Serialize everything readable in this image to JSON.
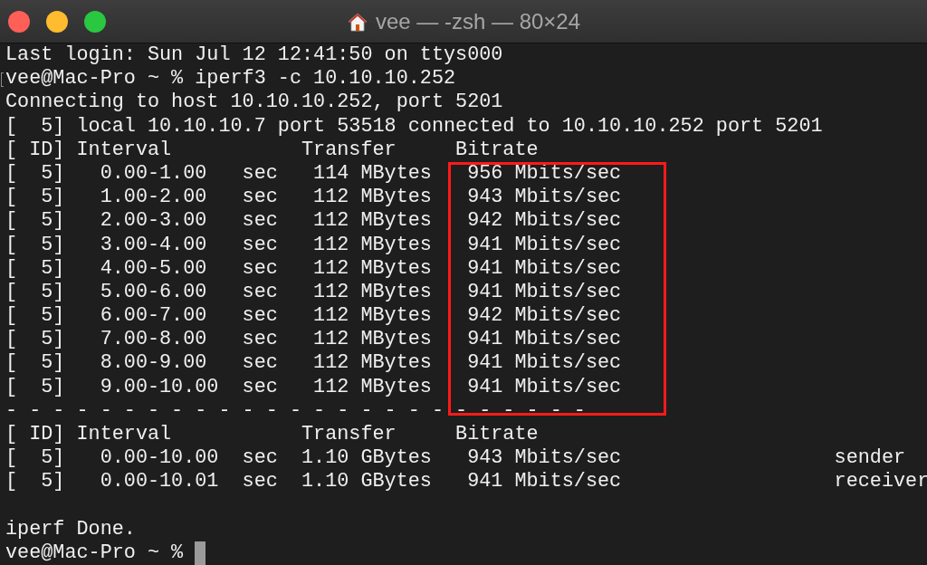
{
  "window": {
    "title": "vee — -zsh — 80×24"
  },
  "lines": [
    {
      "kind": "text",
      "text": "Last login: Sun Jul 12 12:41:50 on ttys000"
    },
    {
      "kind": "marked",
      "text": "vee@Mac-Pro ~ % iperf3 -c 10.10.10.252"
    },
    {
      "kind": "text",
      "text": "Connecting to host 10.10.10.252, port 5201"
    },
    {
      "kind": "text",
      "text": "[  5] local 10.10.10.7 port 53518 connected to 10.10.10.252 port 5201"
    },
    {
      "kind": "text",
      "text": "[ ID] Interval           Transfer     Bitrate"
    },
    {
      "kind": "text",
      "text": "[  5]   0.00-1.00   sec   114 MBytes   956 Mbits/sec"
    },
    {
      "kind": "text",
      "text": "[  5]   1.00-2.00   sec   112 MBytes   943 Mbits/sec"
    },
    {
      "kind": "text",
      "text": "[  5]   2.00-3.00   sec   112 MBytes   942 Mbits/sec"
    },
    {
      "kind": "text",
      "text": "[  5]   3.00-4.00   sec   112 MBytes   941 Mbits/sec"
    },
    {
      "kind": "text",
      "text": "[  5]   4.00-5.00   sec   112 MBytes   941 Mbits/sec"
    },
    {
      "kind": "text",
      "text": "[  5]   5.00-6.00   sec   112 MBytes   941 Mbits/sec"
    },
    {
      "kind": "text",
      "text": "[  5]   6.00-7.00   sec   112 MBytes   942 Mbits/sec"
    },
    {
      "kind": "text",
      "text": "[  5]   7.00-8.00   sec   112 MBytes   941 Mbits/sec"
    },
    {
      "kind": "text",
      "text": "[  5]   8.00-9.00   sec   112 MBytes   941 Mbits/sec"
    },
    {
      "kind": "text",
      "text": "[  5]   9.00-10.00  sec   112 MBytes   941 Mbits/sec"
    },
    {
      "kind": "text",
      "text": "- - - - - - - - - - - - - - - - - - - - - - - - -"
    },
    {
      "kind": "text",
      "text": "[ ID] Interval           Transfer     Bitrate"
    },
    {
      "kind": "text",
      "text": "[  5]   0.00-10.00  sec  1.10 GBytes   943 Mbits/sec                  sender"
    },
    {
      "kind": "text",
      "text": "[  5]   0.00-10.01  sec  1.10 GBytes   941 Mbits/sec                  receiver"
    },
    {
      "kind": "blank"
    },
    {
      "kind": "text",
      "text": "iperf Done."
    },
    {
      "kind": "prompt",
      "text": "vee@Mac-Pro ~ % "
    }
  ],
  "annotation": {
    "kind": "rectangle",
    "color": "#ff1a1a"
  }
}
